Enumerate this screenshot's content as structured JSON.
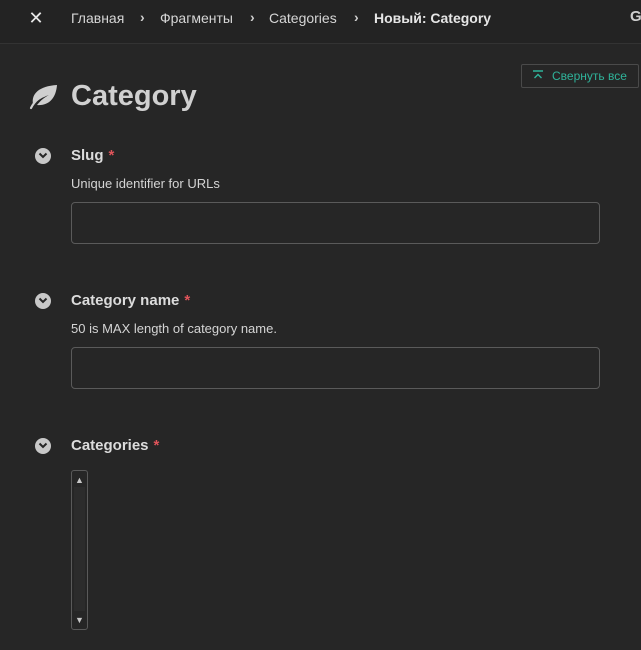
{
  "breadcrumb": {
    "items": [
      "Главная",
      "Фрагменты",
      "Categories"
    ],
    "current": "Новый: Category",
    "corner_glyph": "G"
  },
  "toolbar": {
    "collapse_label": "Свернуть все"
  },
  "page": {
    "title": "Category",
    "icon": "leaf-icon"
  },
  "fields": [
    {
      "label": "Slug",
      "required_mark": "*",
      "help": "Unique identifier for URLs",
      "value": ""
    },
    {
      "label": "Category name",
      "required_mark": "*",
      "help": "50 is MAX length of category name.",
      "value": ""
    },
    {
      "label": "Categories",
      "required_mark": "*"
    }
  ],
  "colors": {
    "background": "#262626",
    "accent": "#2fb39a",
    "required": "#e0545a"
  }
}
